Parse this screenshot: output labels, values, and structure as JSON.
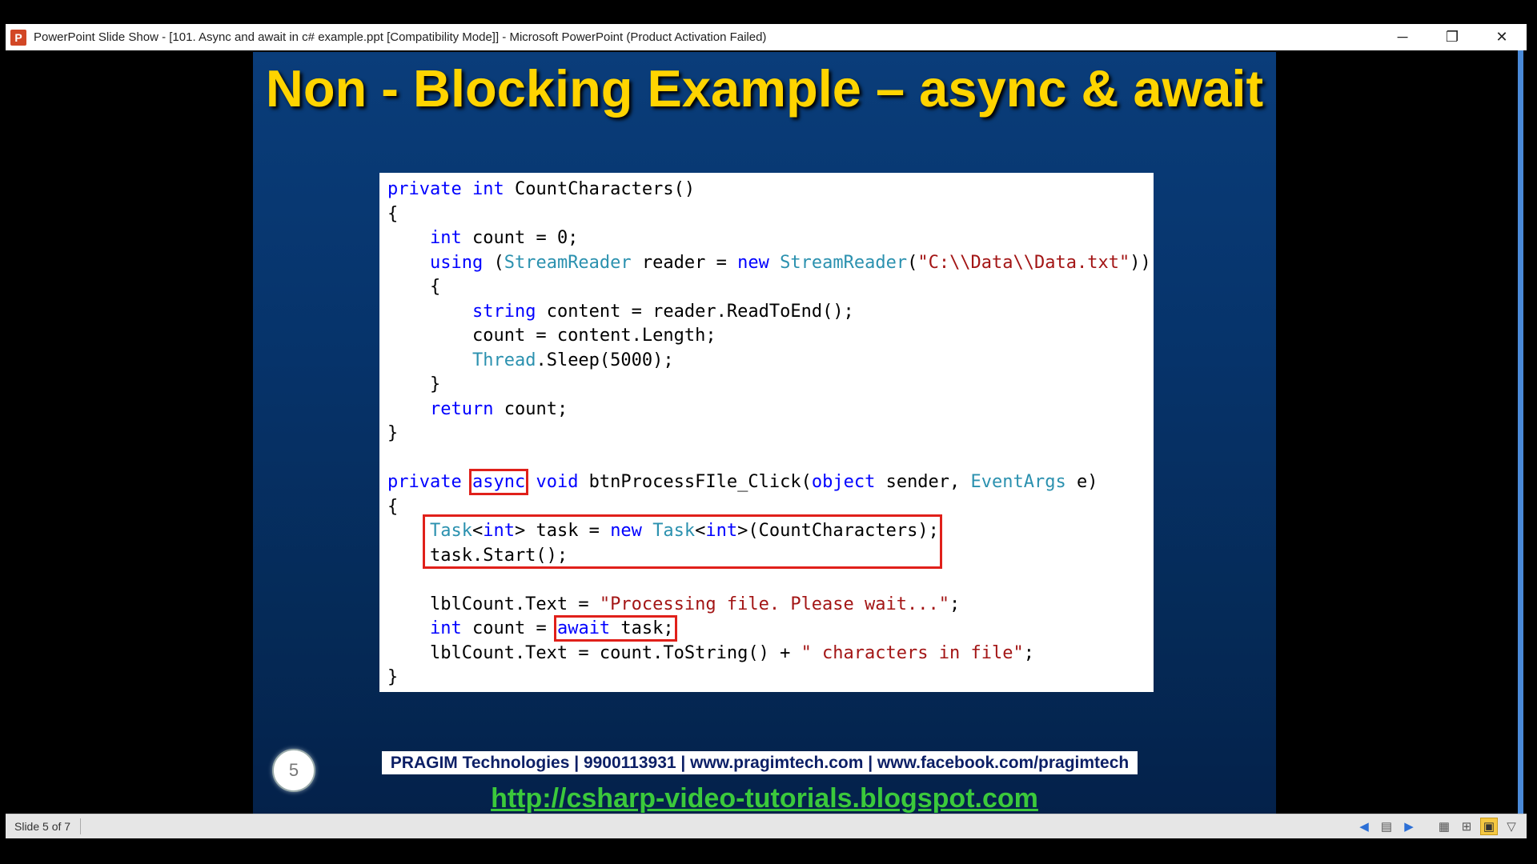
{
  "window": {
    "icon_letter": "P",
    "title": "PowerPoint Slide Show - [101. Async and await in c# example.ppt [Compatibility Mode]] - Microsoft PowerPoint (Product Activation Failed)",
    "controls": {
      "minimize": "─",
      "restore": "❐",
      "close": "✕"
    }
  },
  "slide": {
    "title": "Non - Blocking Example – async & await",
    "number": "5",
    "footer": "PRAGIM Technologies | 9900113931 | www.pragimtech.com | www.facebook.com/pragimtech",
    "link": "http://csharp-video-tutorials.blogspot.com",
    "code_lines": [
      "private int CountCharacters()",
      "{",
      "    int count = 0;",
      "    using (StreamReader reader = new StreamReader(\"C:\\\\Data\\\\Data.txt\"))",
      "    {",
      "        string content = reader.ReadToEnd();",
      "        count = content.Length;",
      "        Thread.Sleep(5000);",
      "    }",
      "    return count;",
      "}",
      "",
      "private async void btnProcessFIle_Click(object sender, EventArgs e)",
      "{",
      "    Task<int> task = new Task<int>(CountCharacters);",
      "    task.Start();",
      "",
      "    lblCount.Text = \"Processing file. Please wait...\";",
      "    int count = await task;",
      "    lblCount.Text = count.ToString() + \" characters in file\";",
      "}"
    ],
    "highlighted_tokens": [
      "async",
      "await task;"
    ],
    "colors": {
      "keyword": "#0000ff",
      "type": "#2b91af",
      "string": "#a31515",
      "highlight_box": "#e0201a",
      "title": "#ffd400",
      "link": "#3bc93b"
    }
  },
  "statusbar": {
    "slide_indicator": "Slide 5 of 7",
    "icons": [
      "previous-arrow-icon",
      "menu-icon",
      "next-arrow-icon",
      "normal-view-icon",
      "slide-sorter-icon",
      "reading-view-icon",
      "slide-show-icon"
    ]
  }
}
